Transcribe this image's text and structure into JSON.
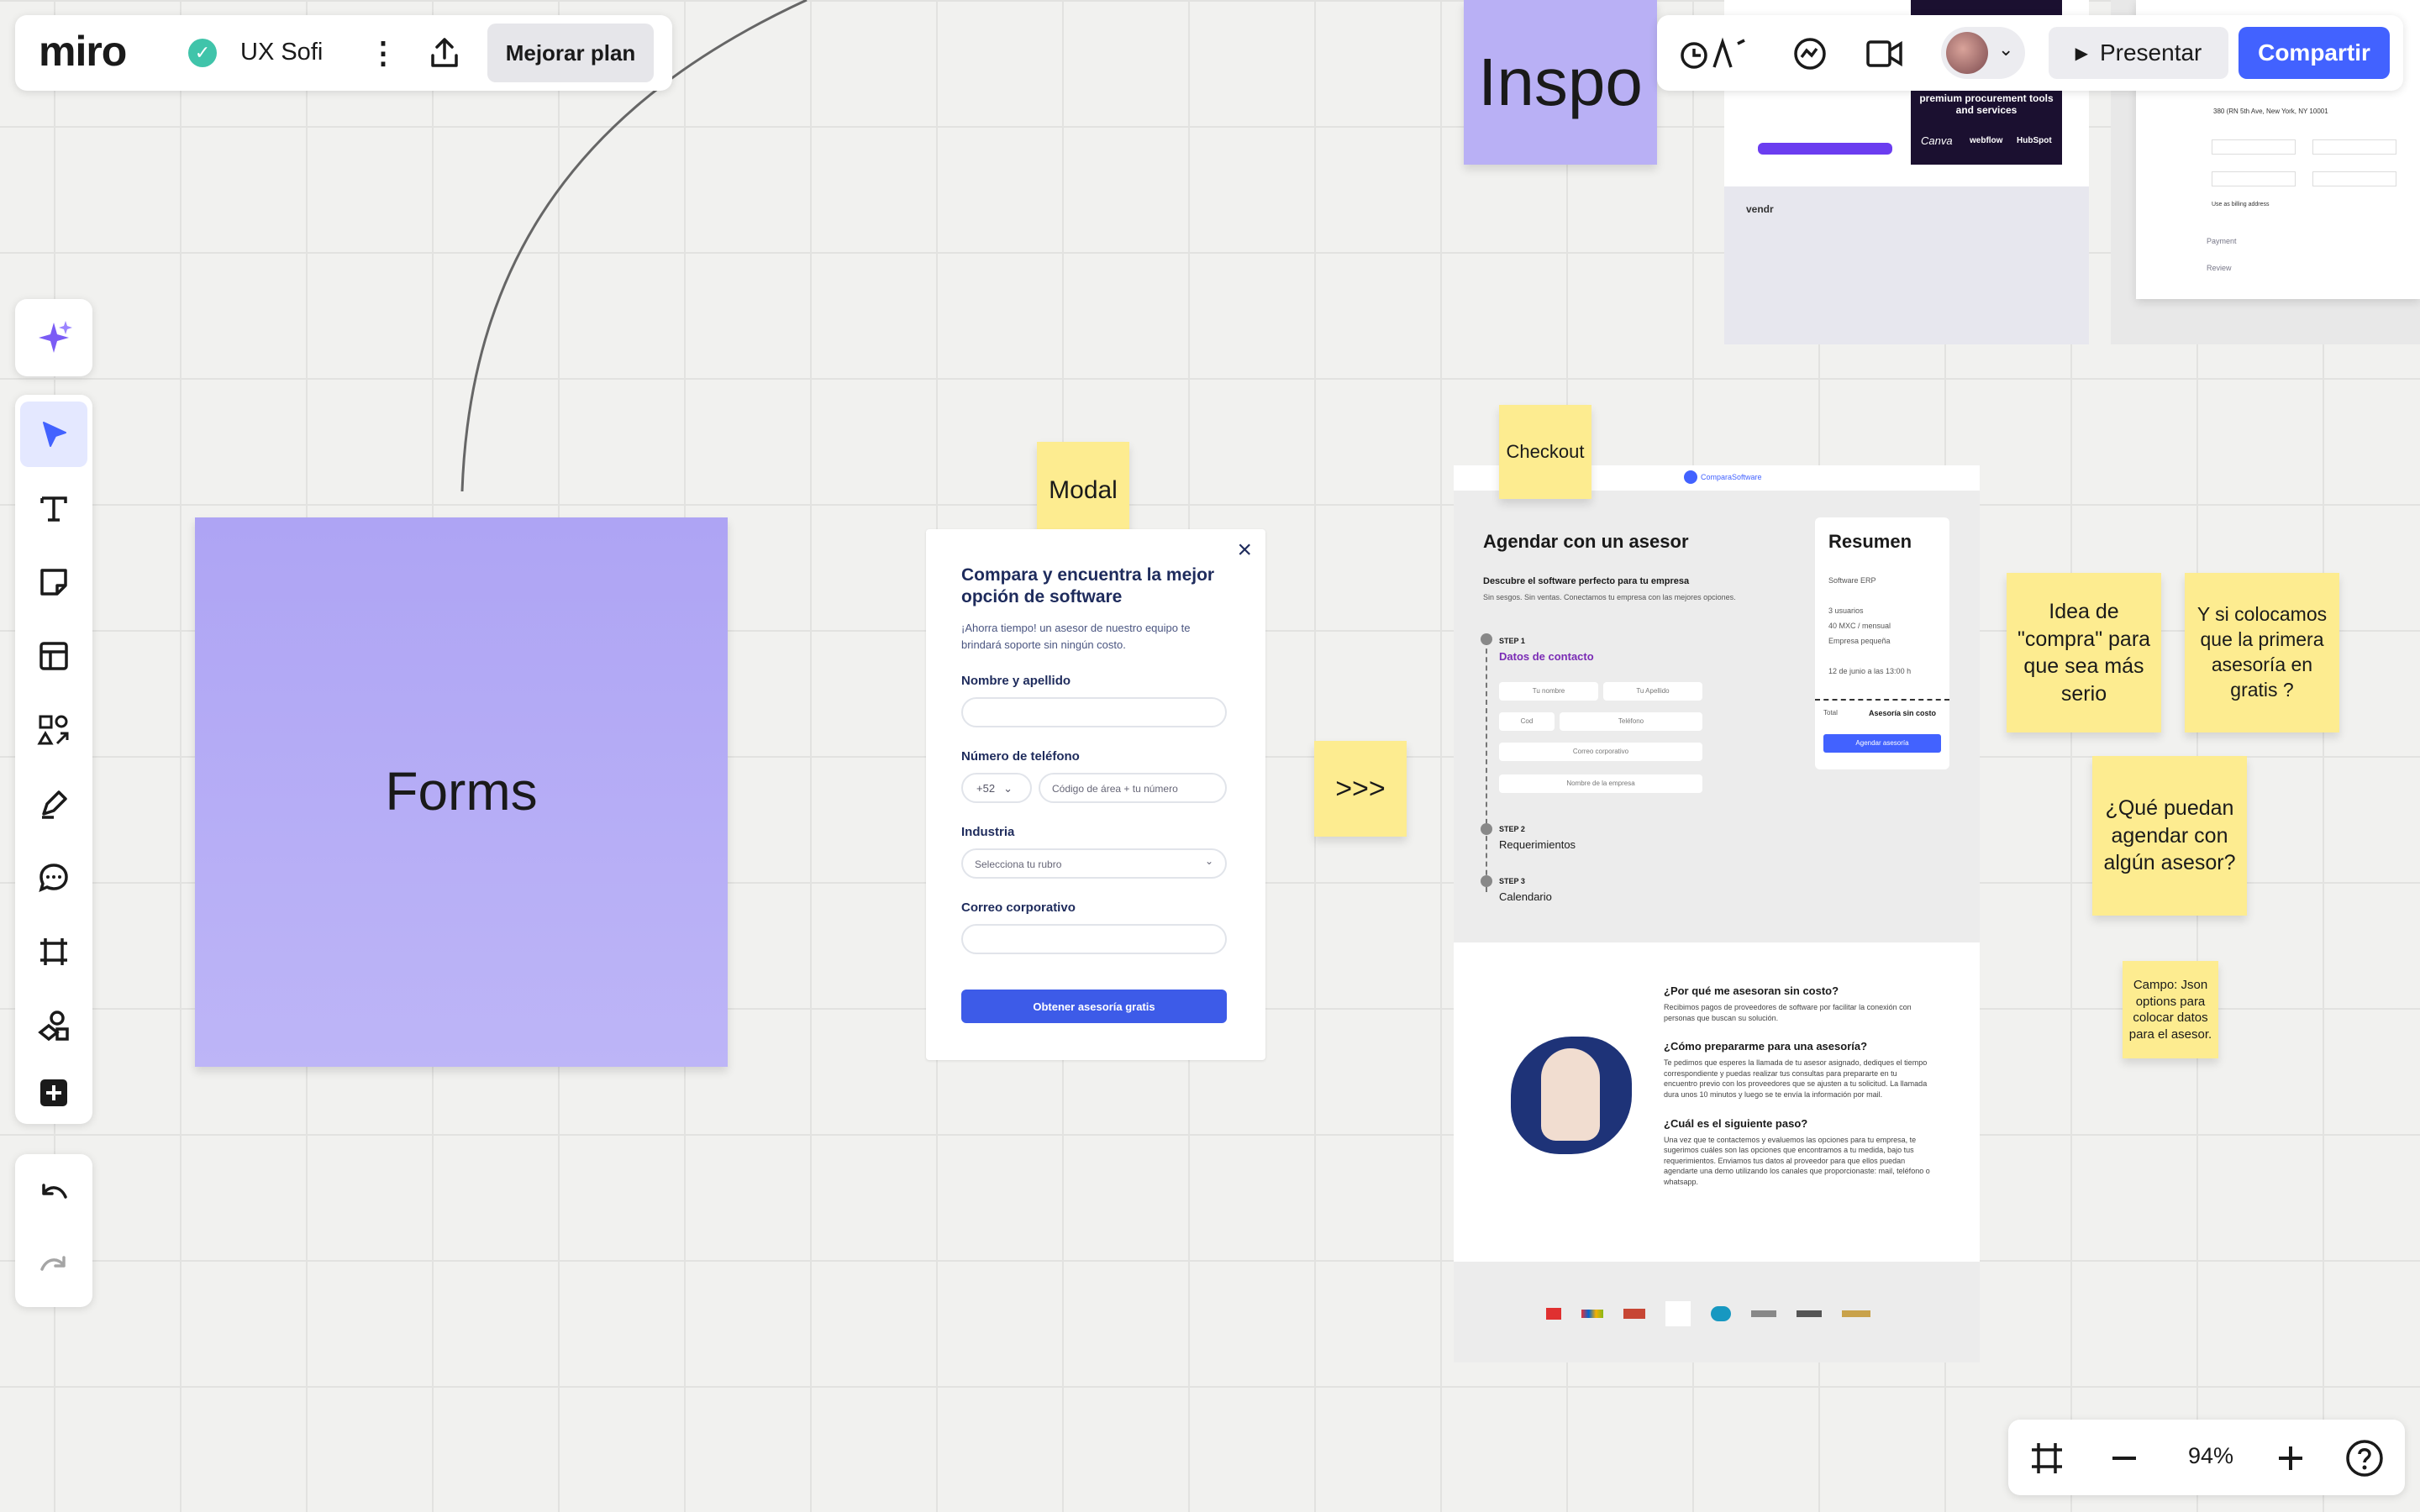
{
  "app": {
    "logo": "miro",
    "board_name": "UX Sofi",
    "upgrade_label": "Mejorar plan"
  },
  "topbar": {
    "present_label": "Presentar",
    "share_label": "Compartir",
    "inspo_label": "Inspo"
  },
  "zoom": {
    "level": "94%"
  },
  "stickies": {
    "forms": "Forms",
    "modal": "Modal",
    "checkout": "Checkout",
    "arrows": ">>>",
    "idea": "Idea de \"compra\" para que sea más serio",
    "primera": "Y si colocamos que la primera asesoría en gratis ?",
    "agendar": "¿Qué puedan agendar con algún asesor?",
    "campo": "Campo: Json options para colocar datos para el asesor."
  },
  "modal": {
    "title": "Compara y encuentra la mejor opción de software",
    "subtitle": "¡Ahorra tiempo! un asesor de nuestro equipo te brindará soporte sin ningún costo.",
    "name_label": "Nombre y apellido",
    "phone_label": "Número de teléfono",
    "phone_prefix": "+52",
    "phone_placeholder": "Código de área + tu número",
    "industry_label": "Industria",
    "industry_placeholder": "Selecciona tu rubro",
    "email_label": "Correo corporativo",
    "submit_label": "Obtener asesoría gratis"
  },
  "checkout": {
    "brand": "ComparaSoftware",
    "title": "Agendar con un asesor",
    "subtitle": "Descubre el software perfecto para tu empresa",
    "caption": "Sin sesgos. Sin ventas. Conectamos tu empresa con las mejores opciones.",
    "step1": "STEP 1",
    "step1_title": "Datos de contacto",
    "field_name": "Tu nombre",
    "field_last": "Tu Apellido",
    "field_cod": "Cod",
    "field_phone": "Teléfono",
    "field_email": "Correo corporativo",
    "field_company": "Nombre de la empresa",
    "step2": "STEP 2",
    "step2_title": "Requerimientos",
    "step3": "STEP 3",
    "step3_title": "Calendario",
    "summary_title": "Resumen",
    "summary_lines": [
      "Software ERP",
      "3 usuarios",
      "40 MXC / mensual",
      "Empresa pequeña",
      "12 de junio a las 13:00 h"
    ],
    "summary_total_label": "Total",
    "summary_total_value": "Asesoría sin costo",
    "summary_button": "Agendar asesoría"
  },
  "faq": [
    {
      "q": "¿Por qué me asesoran sin costo?",
      "a": "Recibimos pagos de proveedores de software por facilitar la conexión con personas que buscan su solución."
    },
    {
      "q": "¿Cómo prepararme para una asesoría?",
      "a": "Te pedimos que esperes la llamada de tu asesor asignado, dediques el tiempo correspondiente y puedas realizar tus consultas para prepararte en tu encuentro previo con los proveedores que se ajusten a tu solicitud. La llamada dura unos 10 minutos y luego se te envía la información por mail."
    },
    {
      "q": "¿Cuál es el siguiente paso?",
      "a": "Una vez que te contactemos y evaluemos las opciones para tu empresa, te sugerimos cuáles son las opciones que encontramos a tu medida, bajo tus requerimientos. Enviamos tus datos al proveedor para que ellos puedan agendarte una demo utilizando los canales que proporcionaste: mail, teléfono o whatsapp."
    }
  ],
  "inspo": {
    "banner_text": "premium procurement tools and services",
    "logos": [
      "Canva",
      "webflow",
      "HubSpot"
    ],
    "vendr": "vendr",
    "address": "380 (RN 5th Ave, New York, NY 10001",
    "payment": "Payment",
    "review": "Review",
    "billing": "Use as billing address"
  },
  "colors": {
    "brand_blue": "#4262ff",
    "sticky_yellow": "#fdec90",
    "sticky_purple": "#b9b0f5",
    "form_blue": "#3d5be8"
  }
}
